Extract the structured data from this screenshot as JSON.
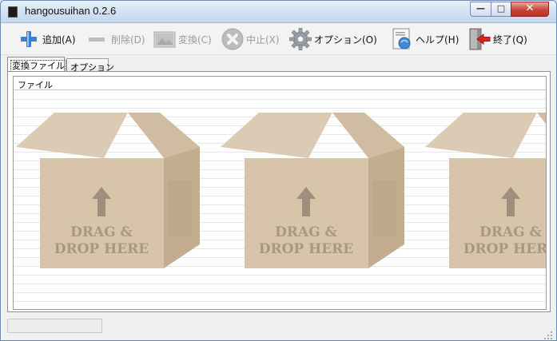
{
  "window": {
    "title": "hangousuihan 0.2.6"
  },
  "window_controls": {
    "minimize": "—",
    "maximize": "□",
    "close": "✕"
  },
  "toolbar": {
    "add": {
      "label": "追加(A)",
      "icon": "plus-icon"
    },
    "delete": {
      "label": "削除(D)",
      "icon": "minus-icon",
      "disabled": true
    },
    "convert": {
      "label": "変換(C)",
      "icon": "image-icon",
      "disabled": true
    },
    "stop": {
      "label": "中止(X)",
      "icon": "stop-icon",
      "disabled": true
    },
    "options": {
      "label": "オプション(O)",
      "icon": "gear-icon"
    },
    "help": {
      "label": "ヘルプ(H)",
      "icon": "help-document-icon"
    },
    "exit": {
      "label": "終了(Q)",
      "icon": "exit-door-icon"
    }
  },
  "tabs": [
    {
      "label": "変換ファイル",
      "selected": true
    },
    {
      "label": "オプション",
      "selected": false
    }
  ],
  "file_list": {
    "column_header": "ファイル",
    "dropzone_text_line1": "DRAG &",
    "dropzone_text_line2": "DROP HERE"
  },
  "colors": {
    "box_tan": "#d7c4aa",
    "box_dark": "#c4ad8f",
    "box_text": "#a89784",
    "close_red": "#c8453a"
  }
}
